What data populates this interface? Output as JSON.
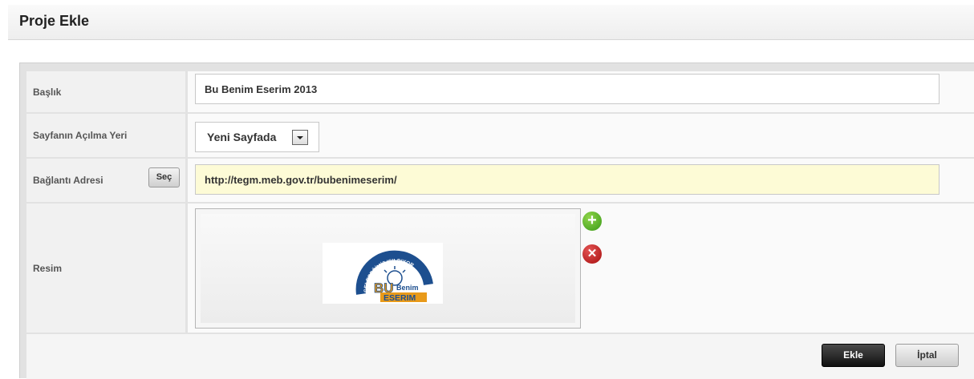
{
  "header": {
    "title": "Proje Ekle"
  },
  "form": {
    "baslik": {
      "label": "Başlık",
      "value": "Bu Benim Eserim 2013"
    },
    "acilma_yeri": {
      "label": "Sayfanın Açılma Yeri",
      "selected": "Yeni Sayfada"
    },
    "baglanti": {
      "label": "Bağlantı Adresi",
      "select_button": "Seç",
      "value": "http://tegm.meb.gov.tr/bubenimeserim/"
    },
    "resim": {
      "label": "Resim",
      "logo_arc_text": "GELECEĞİMİZ IŞILDIYOR",
      "logo_word1": "BU",
      "logo_word2": "Benim",
      "logo_word3": "ESERIM",
      "add_icon": "plus-circle-icon",
      "remove_icon": "x-circle-icon"
    }
  },
  "buttons": {
    "add": "Ekle",
    "cancel": "İptal"
  }
}
